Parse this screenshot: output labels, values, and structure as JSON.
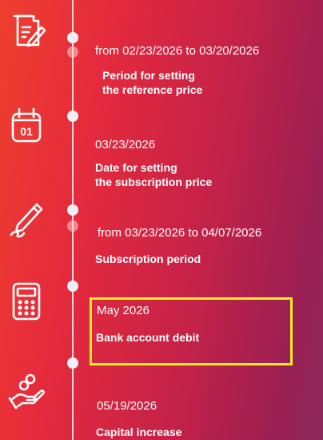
{
  "steps": [
    {
      "date_prefix": "from",
      "date_start": "02/23/2026",
      "date_joiner": "to",
      "date_end": "03/20/2026",
      "label_line1": "Period for setting",
      "label_line2": "the reference price",
      "icon": "document-edit-icon"
    },
    {
      "date": "03/23/2026",
      "label_line1": "Date for setting",
      "label_line2": "the subscription price",
      "icon": "calendar-icon"
    },
    {
      "date_prefix": "from",
      "date_start": "03/23/2026",
      "date_joiner": "to",
      "date_end": "04/07/2026",
      "label_line1": "Subscription period",
      "icon": "pen-signature-icon"
    },
    {
      "date": "May 2026",
      "label_line1": "Bank account debit",
      "icon": "calculator-icon",
      "highlighted": true
    },
    {
      "date": "05/19/2026",
      "label_line1": "Capital increase",
      "icon": "hand-coins-icon"
    }
  ],
  "colors": {
    "background_start": "#ef3f2e",
    "background_end": "#8a2a5a",
    "highlight_border": "#f4ee2a",
    "timeline": "#f3d6da"
  }
}
